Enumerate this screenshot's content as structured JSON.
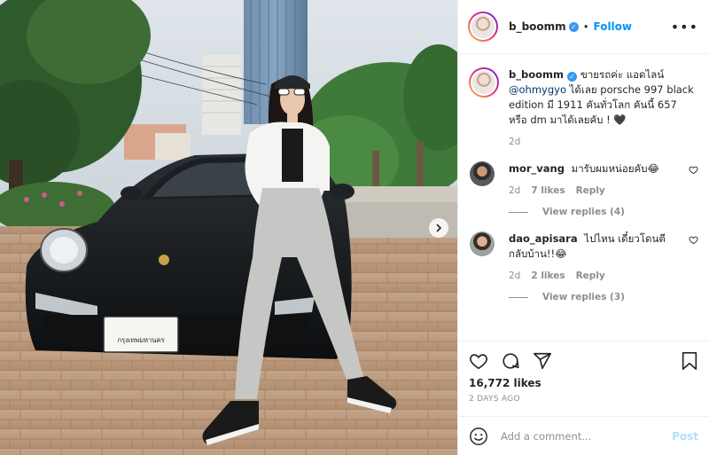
{
  "post": {
    "author": "b_boomm",
    "follow_label": "Follow",
    "more_label": "•••",
    "separator": "•",
    "caption_text": "ขายรถค่ะ แอดไลน์",
    "caption_mention": "@ohmygyo",
    "caption_rest": "ได้เลย porsche 997 black edition มี 1911 คันทั่วโลก คันนี้ 657 หรือ dm มาได้เลยคับ ! 🖤",
    "caption_age": "2d",
    "likes": "16,772 likes",
    "posted": "2 DAYS AGO",
    "license_plate": "กรุงเทพมหานคร"
  },
  "comments": [
    {
      "user": "mor_vang",
      "text": "มารับผมหน่อยคับ😂",
      "age": "2d",
      "likes": "7 likes",
      "reply_label": "Reply",
      "view_replies": "View replies (4)"
    },
    {
      "user": "dao_apisara",
      "text": "ไปไหน เดี๋ยวโดนตี กลับบ้าน!!😂",
      "age": "2d",
      "likes": "2 likes",
      "reply_label": "Reply",
      "view_replies": "View replies (3)"
    }
  ],
  "composer": {
    "placeholder": "Add a comment...",
    "post_label": "Post"
  },
  "colors": {
    "accent": "#0095f6",
    "verified": "#3897f0",
    "muted": "#8e8e8e"
  },
  "icons": [
    "heart-icon",
    "comment-icon",
    "share-icon",
    "bookmark-icon",
    "emoji-icon",
    "chevron-right-icon",
    "more-icon",
    "verified-badge-icon"
  ]
}
